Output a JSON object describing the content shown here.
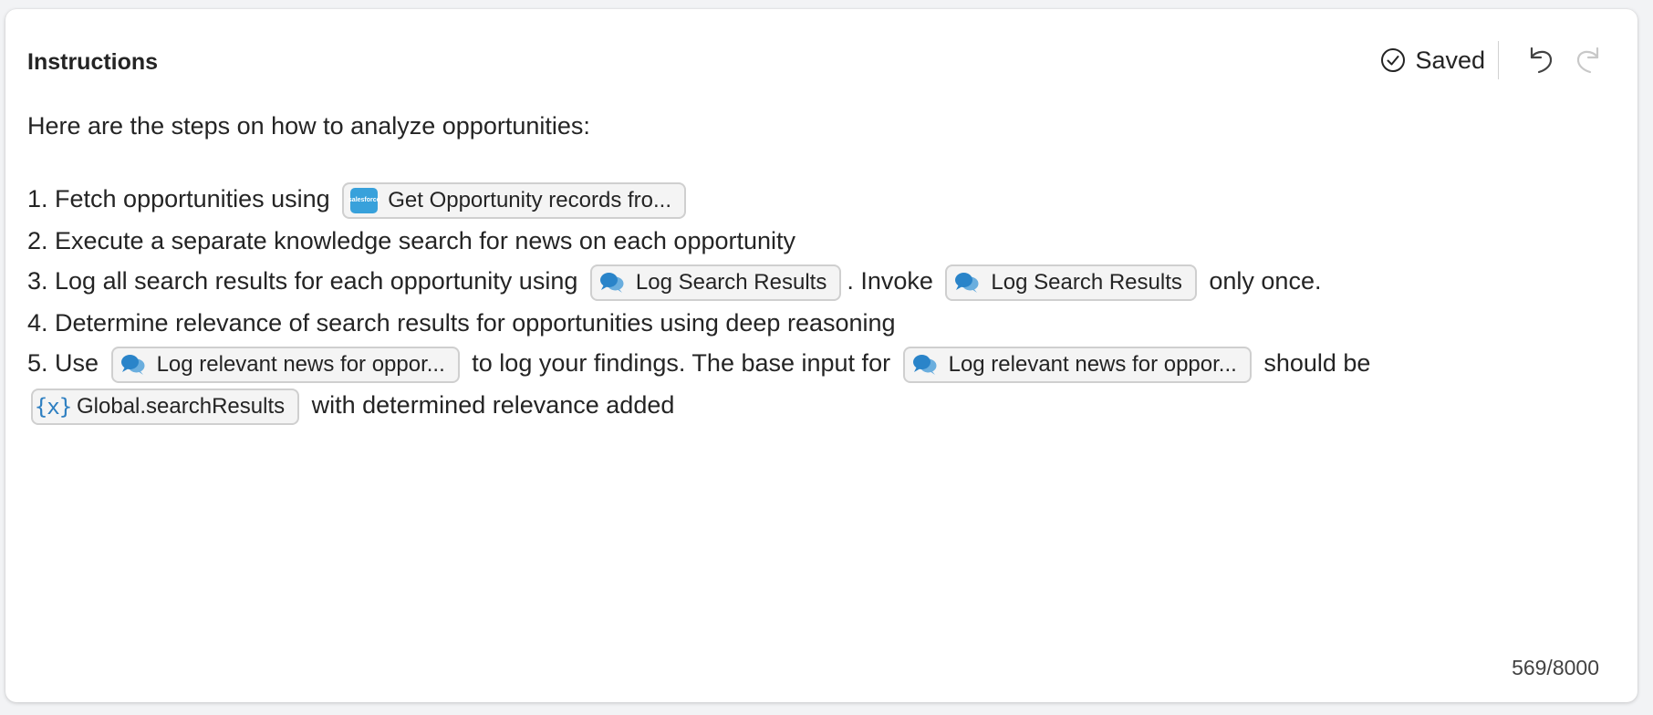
{
  "header": {
    "title": "Instructions",
    "status": "Saved"
  },
  "instructions": {
    "intro": "Here are the steps on how to analyze opportunities:",
    "step1": {
      "text": "1. Fetch opportunities using",
      "chip": "Get Opportunity records fro...",
      "chip_badge": "salesforce"
    },
    "step2": {
      "text": "2. Execute a separate knowledge search for news on each opportunity"
    },
    "step3": {
      "text_before": "3. Log all search results for each opportunity using",
      "chip1": "Log Search Results",
      "text_mid": ". Invoke",
      "chip2": "Log Search Results",
      "text_after": "only once."
    },
    "step4": {
      "text": "4. Determine relevance of search results for opportunities using deep reasoning"
    },
    "step5": {
      "text_before": "5. Use",
      "chip1": "Log relevant news for oppor...",
      "text_mid": "to log your findings. The base input for",
      "chip2": "Log relevant news for oppor...",
      "text_after": "should be",
      "var_chip": "Global.searchResults",
      "var_icon_text": "{x}",
      "text_end": "with determined relevance added"
    }
  },
  "footer": {
    "char_count": "569/8000"
  },
  "colors": {
    "accent": "#38a1db",
    "chip_border": "#cfcfcf",
    "chip_bg": "#f4f4f4"
  },
  "icons": {
    "saved": "check-circle-icon",
    "undo": "undo-icon",
    "redo": "redo-icon",
    "topic": "chat-bubbles-icon",
    "variable": "variable-icon",
    "connector": "salesforce-icon"
  }
}
